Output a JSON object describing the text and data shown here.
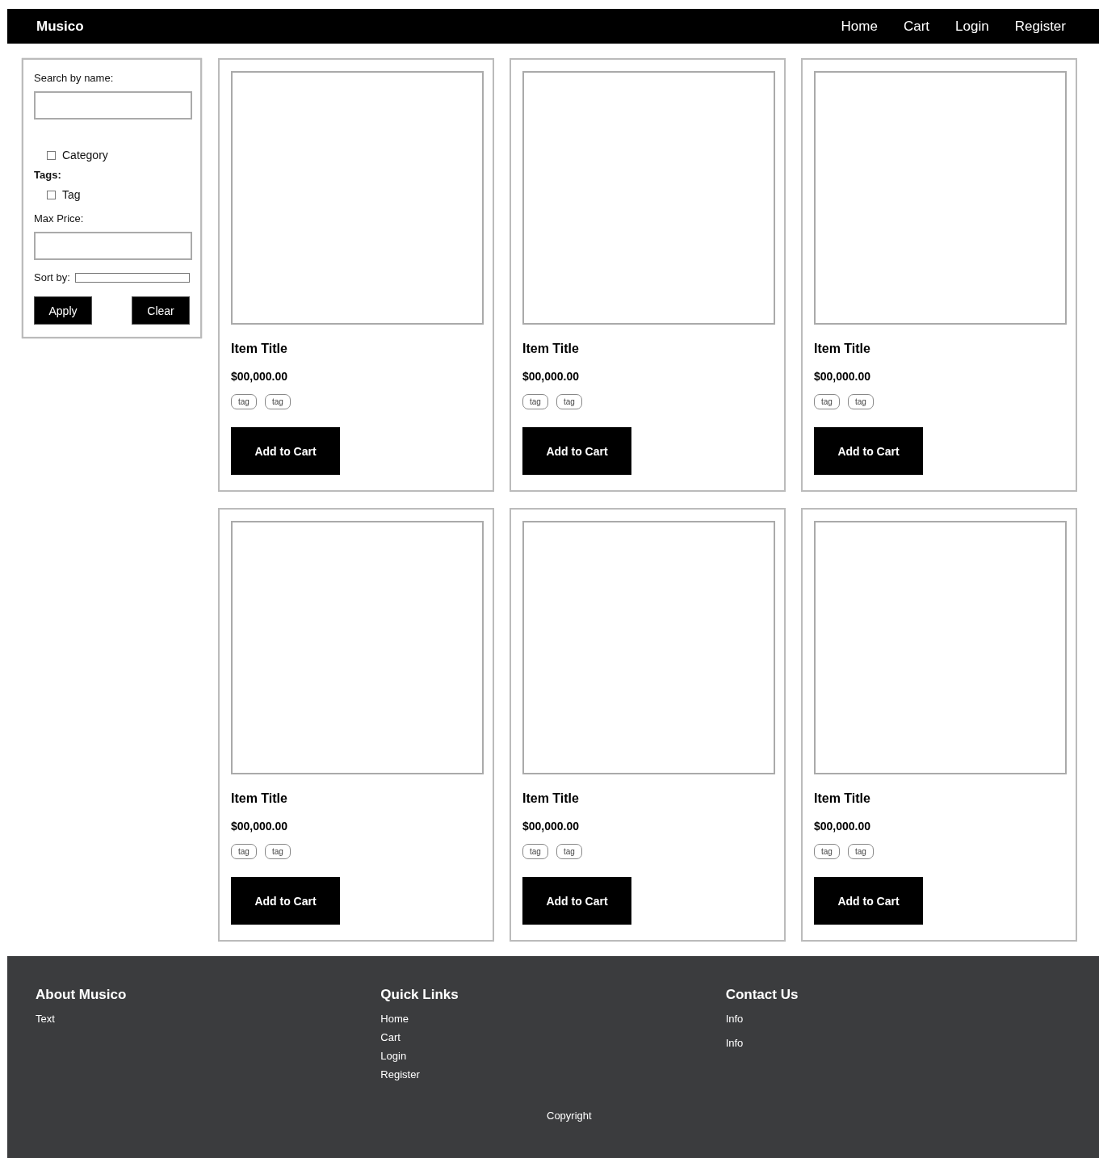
{
  "header": {
    "brand": "Musico",
    "nav": [
      "Home",
      "Cart",
      "Login",
      "Register"
    ]
  },
  "filters": {
    "search_label": "Search by name:",
    "categories": [
      {
        "label": "Category",
        "checked": false
      }
    ],
    "tags_label": "Tags:",
    "tags": [
      {
        "label": "Tag",
        "checked": false
      }
    ],
    "max_price_label": "Max Price:",
    "sort_label": "Sort by:",
    "apply": "Apply",
    "clear": "Clear"
  },
  "products": [
    {
      "title": "Item Title",
      "price": "$00,000.00",
      "tags": [
        "tag",
        "tag"
      ],
      "button": "Add to Cart"
    },
    {
      "title": "Item Title",
      "price": "$00,000.00",
      "tags": [
        "tag",
        "tag"
      ],
      "button": "Add to Cart"
    },
    {
      "title": "Item Title",
      "price": "$00,000.00",
      "tags": [
        "tag",
        "tag"
      ],
      "button": "Add to Cart"
    },
    {
      "title": "Item Title",
      "price": "$00,000.00",
      "tags": [
        "tag",
        "tag"
      ],
      "button": "Add to Cart"
    },
    {
      "title": "Item Title",
      "price": "$00,000.00",
      "tags": [
        "tag",
        "tag"
      ],
      "button": "Add to Cart"
    },
    {
      "title": "Item Title",
      "price": "$00,000.00",
      "tags": [
        "tag",
        "tag"
      ],
      "button": "Add to Cart"
    }
  ],
  "footer": {
    "columns": [
      {
        "heading": "About Musico",
        "items": [
          "Text"
        ],
        "kind": "text"
      },
      {
        "heading": "Quick Links",
        "items": [
          "Home",
          "Cart",
          "Login",
          "Register"
        ],
        "kind": "links"
      },
      {
        "heading": "Contact Us",
        "items": [
          "Info",
          "Info"
        ],
        "kind": "info"
      }
    ],
    "copyright": "Copyright"
  }
}
